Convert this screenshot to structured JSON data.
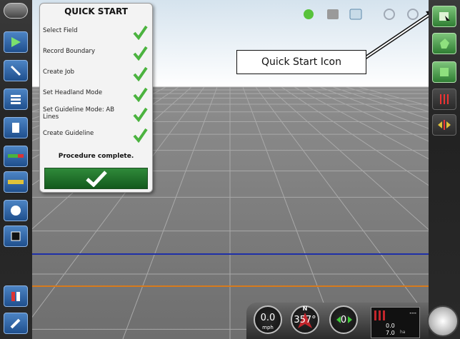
{
  "panel": {
    "title": "QUICK START",
    "steps": [
      {
        "label": "Select Field"
      },
      {
        "label": "Record Boundary"
      },
      {
        "label": "Create Job"
      },
      {
        "label": "Set Headland Mode"
      },
      {
        "label": "Set Guideline Mode: AB Lines"
      },
      {
        "label": "Create Guideline"
      }
    ],
    "complete_text": "Procedure complete."
  },
  "callout": {
    "text": "Quick Start Icon"
  },
  "status": {
    "speed": "0.0",
    "speed_unit": "mph",
    "heading": "357°",
    "heading_marker": "N",
    "satellites": "0",
    "dashes": "---",
    "coverage_1": "0.0",
    "coverage_2": "7.0",
    "coverage_unit": "ha"
  },
  "colors": {
    "accent_blue": "#3f7cc4",
    "check_green": "#4bb33f",
    "guideline_blue": "#1e2fa8",
    "headland_orange": "#d77a1c"
  },
  "icons": [
    "quick-start-icon",
    "field-icon",
    "boundary-icon",
    "guideline-icon",
    "settings-icon",
    "gps-icon",
    "map-icon",
    "camera-icon",
    "wrench-icon"
  ]
}
